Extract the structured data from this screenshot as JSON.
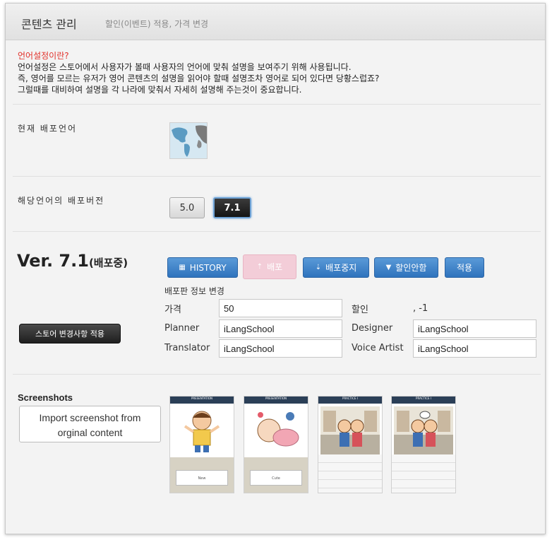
{
  "header": {
    "title": "콘텐츠 관리",
    "subtitle": "할인(이벤트) 적용, 가격 변경"
  },
  "info": {
    "question": "언어설정이란?",
    "lines": [
      "언어설정은 스토어에서 사용자가 볼때 사용자의 언어에 맞춰 설명을 보여주기 위해 사용됩니다.",
      "즉, 영어를 모르는 유저가 영어 콘텐츠의 설명을 읽어야 할때 설명조차 영어로 되어 있다면 당황스럽죠?",
      "그럴때를 대비하여 설명을 각 나라에 맞춰서 자세히 설명해 주는것이 중요합니다."
    ]
  },
  "current_language_label": "현재 배포언어",
  "version_label": "해당언어의 배포버전",
  "versions": [
    "5.0",
    "7.1"
  ],
  "version_title": {
    "main": "Ver. 7.1",
    "status": "(배포중)"
  },
  "actions": {
    "history": "HISTORY",
    "deploy": "배포",
    "stop_deploy": "배포중지",
    "discount": "할인안함",
    "apply": "적용"
  },
  "deploy_info": {
    "title": "배포판 정보 변경",
    "price_label": "가격",
    "price_value": "50",
    "discount_label": "할인",
    "discount_value": ", -1",
    "planner_label": "Planner",
    "planner_value": "iLangSchool",
    "designer_label": "Designer",
    "designer_value": "iLangSchool",
    "translator_label": "Translator",
    "translator_value": "iLangSchool",
    "voice_label": "Voice Artist",
    "voice_value": "iLangSchool"
  },
  "store_button": "스토어 변경사항 적용",
  "screenshots": {
    "title": "Screenshots",
    "import_line1": "Import screenshot from",
    "import_line2": "orginal content",
    "items": [
      {
        "header": "PRESENTATION",
        "caption": "New"
      },
      {
        "header": "PRESENTATION",
        "caption": "Cute"
      },
      {
        "header": "PRACTICE I",
        "caption": ""
      },
      {
        "header": "PRACTICE I",
        "caption": ""
      }
    ]
  },
  "colors": {
    "primary_button": "#3a7fc6",
    "question": "#e2312a",
    "dark_button": "#222222"
  }
}
